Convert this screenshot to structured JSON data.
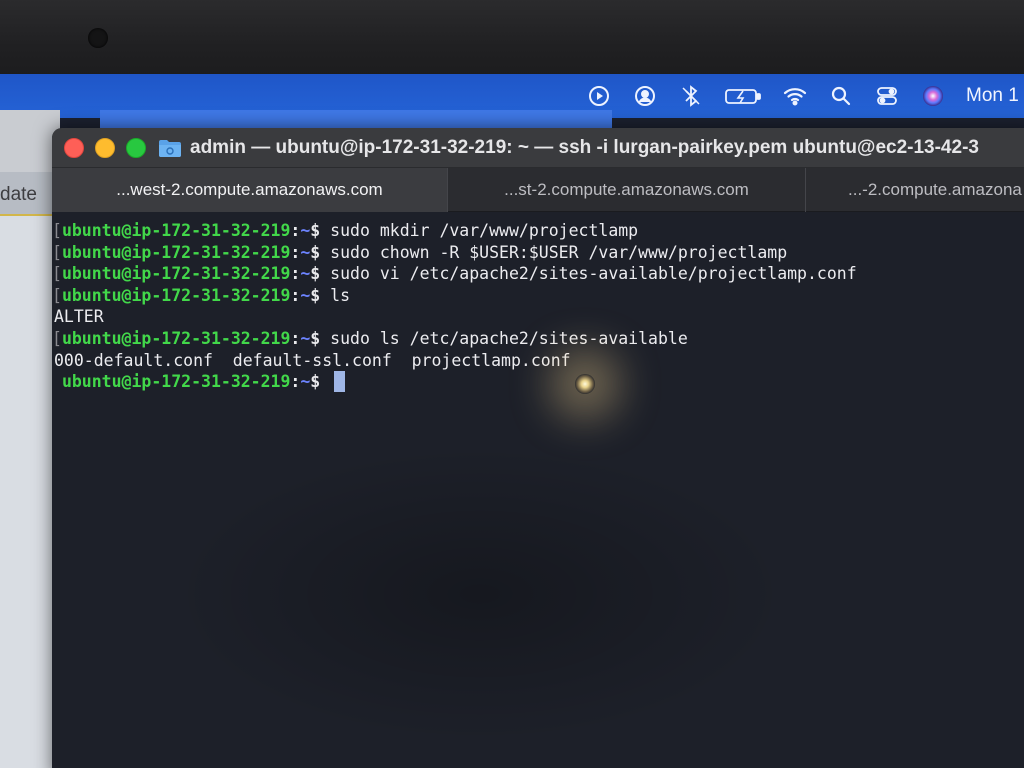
{
  "menubar": {
    "icons": [
      "play-circle-icon",
      "user-circle-icon",
      "bluetooth-icon",
      "battery-icon",
      "wifi-icon",
      "search-icon",
      "control-center-icon",
      "siri-icon"
    ],
    "clock": "Mon 1"
  },
  "background_window": {
    "label": "date"
  },
  "terminal": {
    "title": "admin — ubuntu@ip-172-31-32-219: ~ — ssh -i lurgan-pairkey.pem ubuntu@ec2-13-42-3",
    "tabs": [
      {
        "label": "...west-2.compute.amazonaws.com",
        "active": true
      },
      {
        "label": "...st-2.compute.amazonaws.com",
        "active": false
      },
      {
        "label": "...-2.compute.amazona",
        "active": false
      }
    ],
    "prompt": {
      "user_host": "ubuntu@ip-172-31-32-219",
      "colon": ":",
      "path": "~",
      "symbol": "$"
    },
    "lines": [
      {
        "type": "cmd",
        "command": "sudo mkdir /var/www/projectlamp"
      },
      {
        "type": "cmd",
        "command": "sudo chown -R $USER:$USER /var/www/projectlamp"
      },
      {
        "type": "cmd",
        "command": "sudo vi /etc/apache2/sites-available/projectlamp.conf"
      },
      {
        "type": "cmd",
        "command": "ls"
      },
      {
        "type": "out",
        "text": "ALTER"
      },
      {
        "type": "cmd",
        "command": "sudo ls /etc/apache2/sites-available"
      },
      {
        "type": "out",
        "text": "000-default.conf  default-ssl.conf  projectlamp.conf"
      },
      {
        "type": "prompt",
        "command": ""
      }
    ]
  },
  "colors": {
    "menubar": "#2563d6",
    "prompt_user": "#42d84a",
    "prompt_path": "#6d84ff",
    "terminal_bg": "#1d2029",
    "titlebar": "#3a3b3e"
  }
}
